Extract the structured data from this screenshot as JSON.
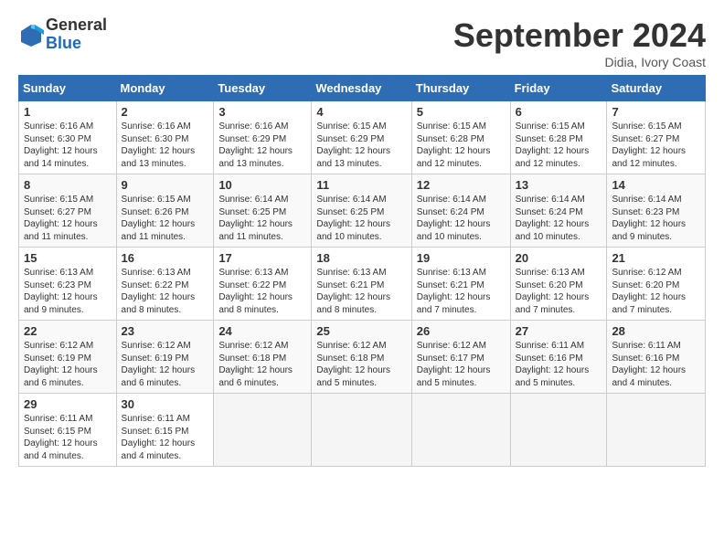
{
  "logo": {
    "general": "General",
    "blue": "Blue"
  },
  "title": "September 2024",
  "location": "Didia, Ivory Coast",
  "days_header": [
    "Sunday",
    "Monday",
    "Tuesday",
    "Wednesday",
    "Thursday",
    "Friday",
    "Saturday"
  ],
  "weeks": [
    [
      {
        "day": "1",
        "info": "Sunrise: 6:16 AM\nSunset: 6:30 PM\nDaylight: 12 hours\nand 14 minutes."
      },
      {
        "day": "2",
        "info": "Sunrise: 6:16 AM\nSunset: 6:30 PM\nDaylight: 12 hours\nand 13 minutes."
      },
      {
        "day": "3",
        "info": "Sunrise: 6:16 AM\nSunset: 6:29 PM\nDaylight: 12 hours\nand 13 minutes."
      },
      {
        "day": "4",
        "info": "Sunrise: 6:15 AM\nSunset: 6:29 PM\nDaylight: 12 hours\nand 13 minutes."
      },
      {
        "day": "5",
        "info": "Sunrise: 6:15 AM\nSunset: 6:28 PM\nDaylight: 12 hours\nand 12 minutes."
      },
      {
        "day": "6",
        "info": "Sunrise: 6:15 AM\nSunset: 6:28 PM\nDaylight: 12 hours\nand 12 minutes."
      },
      {
        "day": "7",
        "info": "Sunrise: 6:15 AM\nSunset: 6:27 PM\nDaylight: 12 hours\nand 12 minutes."
      }
    ],
    [
      {
        "day": "8",
        "info": "Sunrise: 6:15 AM\nSunset: 6:27 PM\nDaylight: 12 hours\nand 11 minutes."
      },
      {
        "day": "9",
        "info": "Sunrise: 6:15 AM\nSunset: 6:26 PM\nDaylight: 12 hours\nand 11 minutes."
      },
      {
        "day": "10",
        "info": "Sunrise: 6:14 AM\nSunset: 6:25 PM\nDaylight: 12 hours\nand 11 minutes."
      },
      {
        "day": "11",
        "info": "Sunrise: 6:14 AM\nSunset: 6:25 PM\nDaylight: 12 hours\nand 10 minutes."
      },
      {
        "day": "12",
        "info": "Sunrise: 6:14 AM\nSunset: 6:24 PM\nDaylight: 12 hours\nand 10 minutes."
      },
      {
        "day": "13",
        "info": "Sunrise: 6:14 AM\nSunset: 6:24 PM\nDaylight: 12 hours\nand 10 minutes."
      },
      {
        "day": "14",
        "info": "Sunrise: 6:14 AM\nSunset: 6:23 PM\nDaylight: 12 hours\nand 9 minutes."
      }
    ],
    [
      {
        "day": "15",
        "info": "Sunrise: 6:13 AM\nSunset: 6:23 PM\nDaylight: 12 hours\nand 9 minutes."
      },
      {
        "day": "16",
        "info": "Sunrise: 6:13 AM\nSunset: 6:22 PM\nDaylight: 12 hours\nand 8 minutes."
      },
      {
        "day": "17",
        "info": "Sunrise: 6:13 AM\nSunset: 6:22 PM\nDaylight: 12 hours\nand 8 minutes."
      },
      {
        "day": "18",
        "info": "Sunrise: 6:13 AM\nSunset: 6:21 PM\nDaylight: 12 hours\nand 8 minutes."
      },
      {
        "day": "19",
        "info": "Sunrise: 6:13 AM\nSunset: 6:21 PM\nDaylight: 12 hours\nand 7 minutes."
      },
      {
        "day": "20",
        "info": "Sunrise: 6:13 AM\nSunset: 6:20 PM\nDaylight: 12 hours\nand 7 minutes."
      },
      {
        "day": "21",
        "info": "Sunrise: 6:12 AM\nSunset: 6:20 PM\nDaylight: 12 hours\nand 7 minutes."
      }
    ],
    [
      {
        "day": "22",
        "info": "Sunrise: 6:12 AM\nSunset: 6:19 PM\nDaylight: 12 hours\nand 6 minutes."
      },
      {
        "day": "23",
        "info": "Sunrise: 6:12 AM\nSunset: 6:19 PM\nDaylight: 12 hours\nand 6 minutes."
      },
      {
        "day": "24",
        "info": "Sunrise: 6:12 AM\nSunset: 6:18 PM\nDaylight: 12 hours\nand 6 minutes."
      },
      {
        "day": "25",
        "info": "Sunrise: 6:12 AM\nSunset: 6:18 PM\nDaylight: 12 hours\nand 5 minutes."
      },
      {
        "day": "26",
        "info": "Sunrise: 6:12 AM\nSunset: 6:17 PM\nDaylight: 12 hours\nand 5 minutes."
      },
      {
        "day": "27",
        "info": "Sunrise: 6:11 AM\nSunset: 6:16 PM\nDaylight: 12 hours\nand 5 minutes."
      },
      {
        "day": "28",
        "info": "Sunrise: 6:11 AM\nSunset: 6:16 PM\nDaylight: 12 hours\nand 4 minutes."
      }
    ],
    [
      {
        "day": "29",
        "info": "Sunrise: 6:11 AM\nSunset: 6:15 PM\nDaylight: 12 hours\nand 4 minutes."
      },
      {
        "day": "30",
        "info": "Sunrise: 6:11 AM\nSunset: 6:15 PM\nDaylight: 12 hours\nand 4 minutes."
      },
      {
        "day": "",
        "info": ""
      },
      {
        "day": "",
        "info": ""
      },
      {
        "day": "",
        "info": ""
      },
      {
        "day": "",
        "info": ""
      },
      {
        "day": "",
        "info": ""
      }
    ]
  ]
}
